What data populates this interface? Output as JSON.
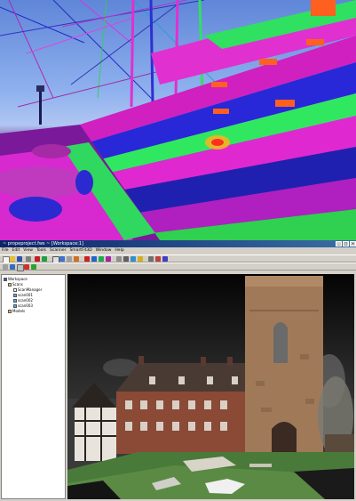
{
  "window": {
    "title": "~ propeproject.fws ~ [Workspace:1]"
  },
  "menu": {
    "items": [
      "File",
      "Edit",
      "View",
      "Tools",
      "Scanner",
      "SmartFit3D",
      "Window",
      "Help"
    ]
  },
  "workspace_tree": {
    "root": "Workspace",
    "items": [
      {
        "label": "Scans",
        "level": 1
      },
      {
        "label": "ScanManager",
        "level": 2
      },
      {
        "label": "scan001",
        "level": 2
      },
      {
        "label": "scan002",
        "level": 2
      },
      {
        "label": "scan003",
        "level": 2
      },
      {
        "label": "Models",
        "level": 1
      }
    ]
  },
  "colors": {
    "title_bar": "#0a246a",
    "window_chrome": "#d4d0c8",
    "viewport_bg": "#1a1a1a",
    "scan_magenta": "#e020d0",
    "scan_green": "#30e860",
    "scan_blue": "#2828e0",
    "scan_sky": "#7aa0e8"
  },
  "icons": {
    "toolbar": [
      "new-icon",
      "open-icon",
      "save-icon",
      "print-icon",
      "undo-icon",
      "redo-icon",
      "select-icon",
      "rotate-icon",
      "pan-icon",
      "zoom-icon",
      "fit-icon",
      "measure-icon"
    ]
  }
}
